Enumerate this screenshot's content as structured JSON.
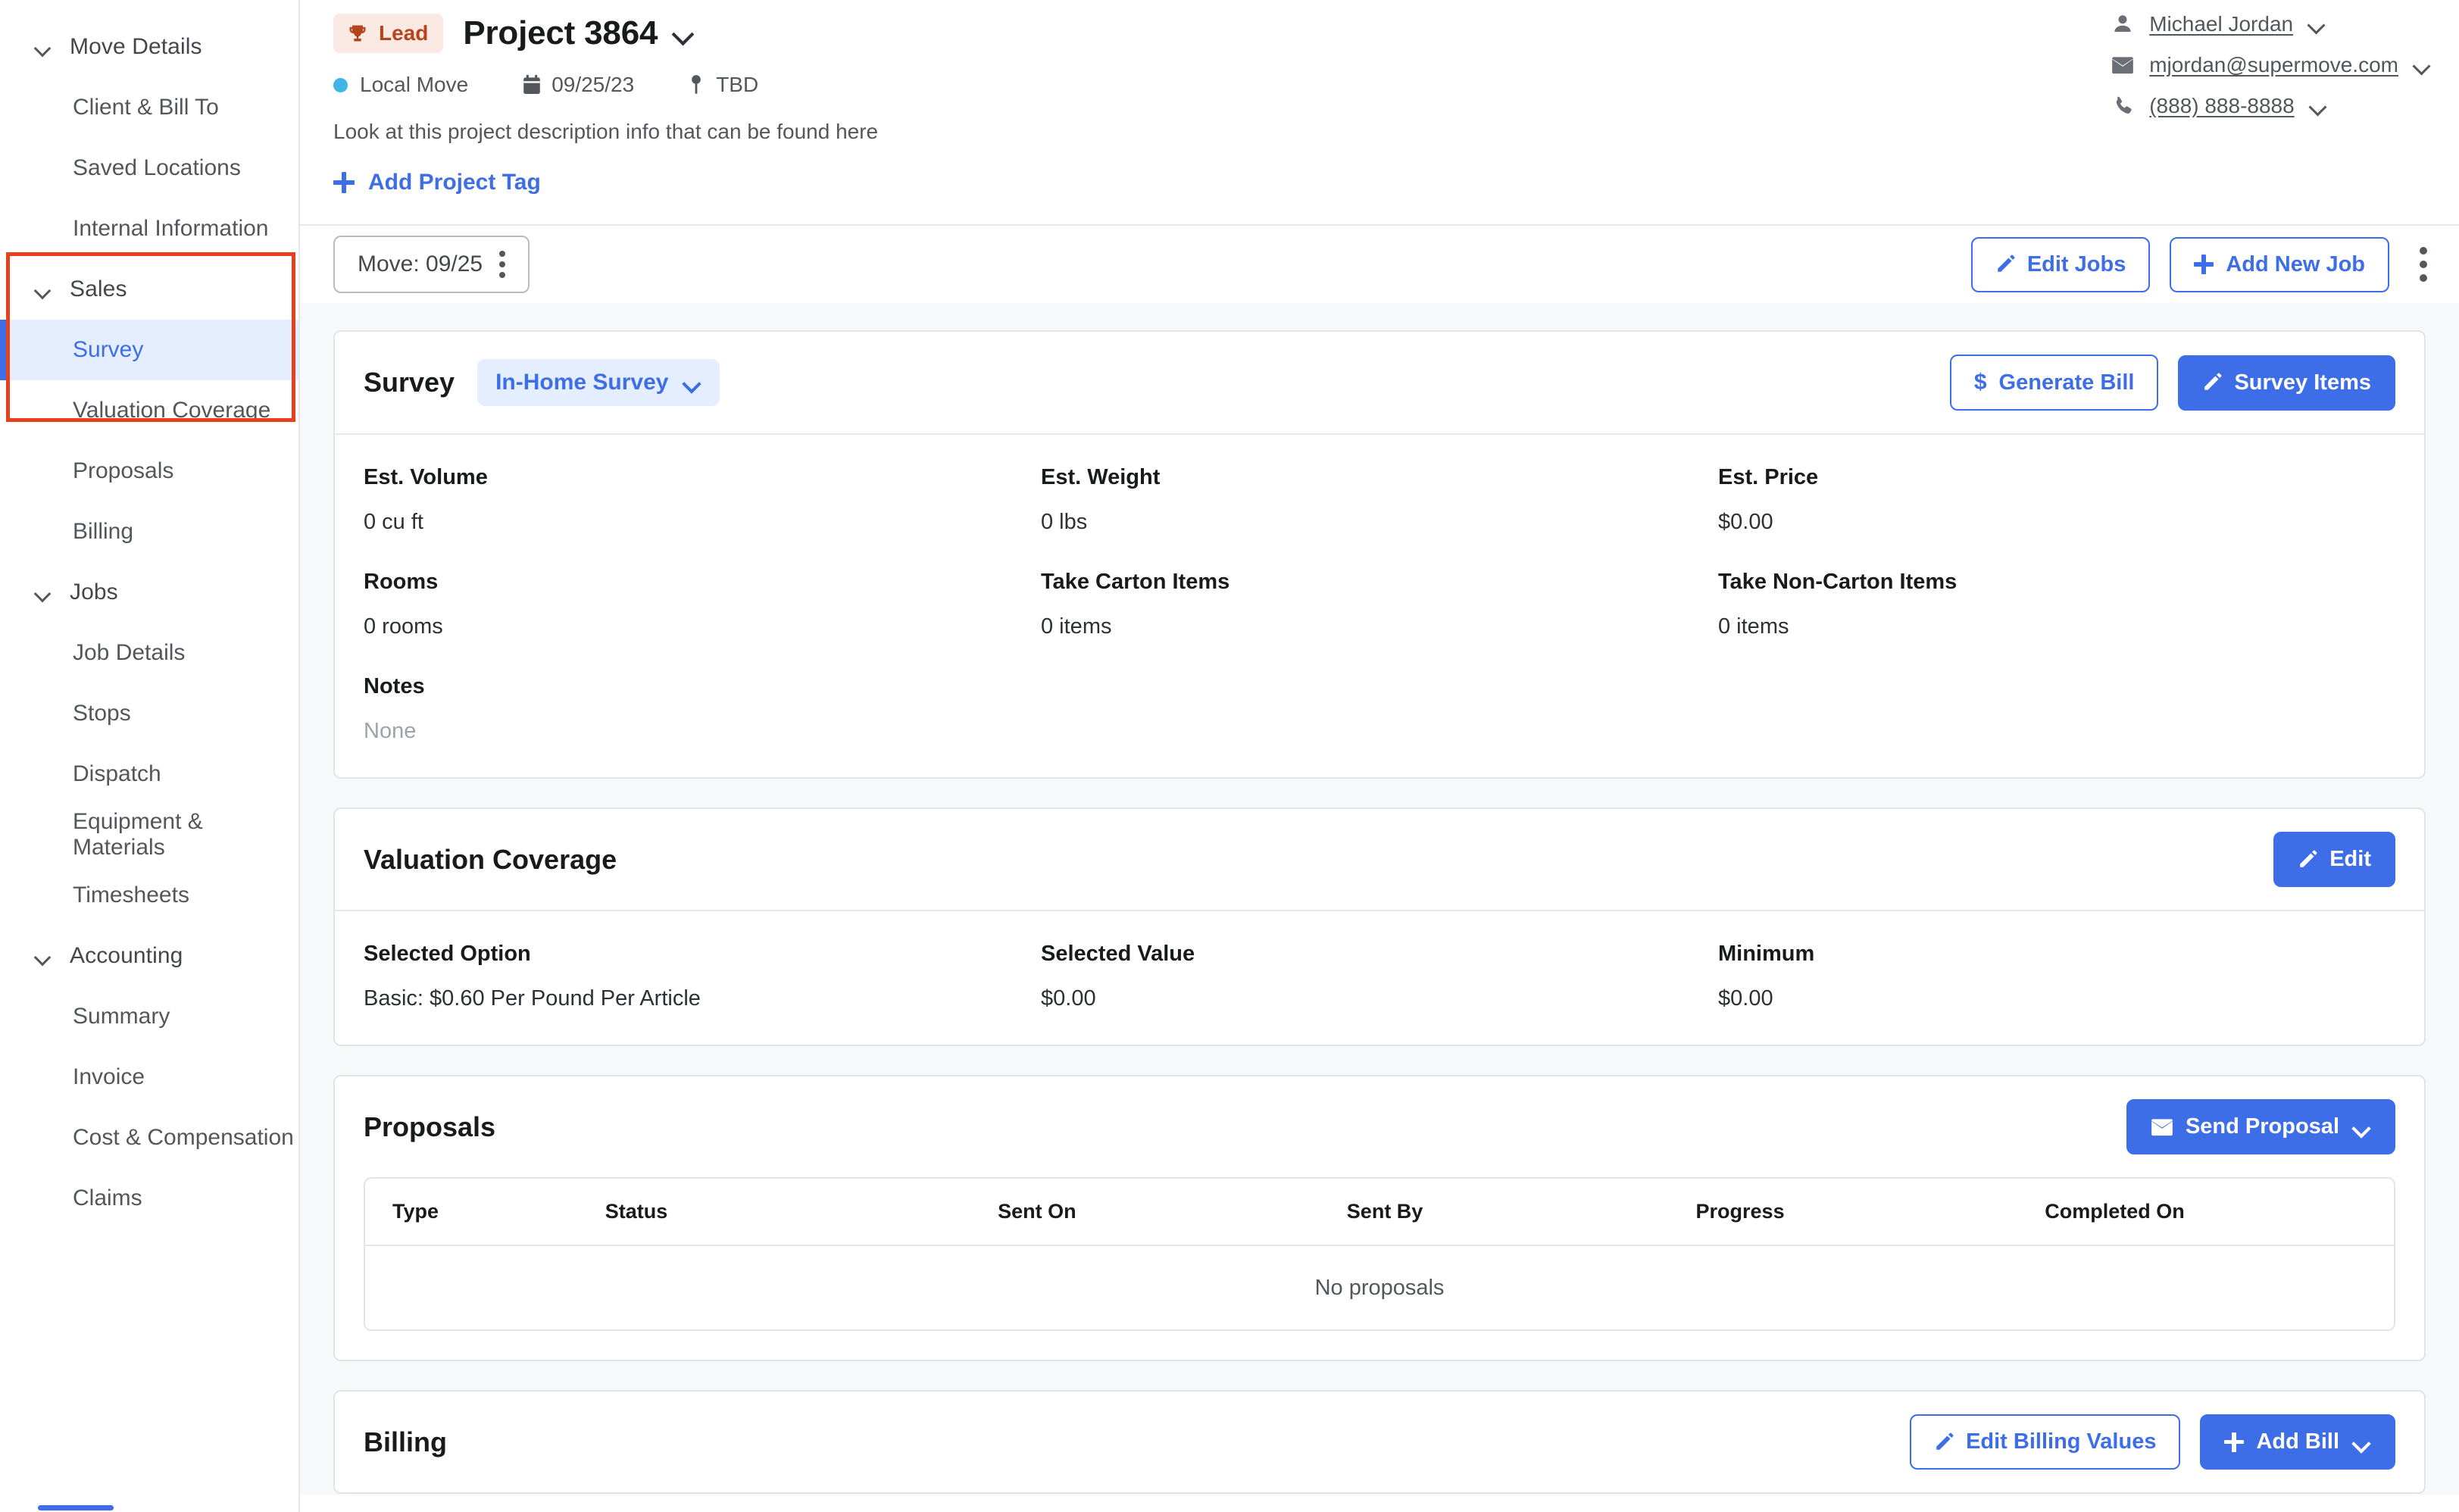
{
  "colors": {
    "accent": "#3d6ee8",
    "accent_soft": "#e4eeff",
    "lead_badge_bg": "#fbeae3",
    "lead_badge_text": "#b5441a",
    "highlight_rect": "#e8401c",
    "move_dot": "#41b6e6"
  },
  "sidebar": {
    "groups": [
      {
        "label": "Move Details",
        "icon": "chevron-down-icon",
        "items": [
          {
            "label": "Client & Bill To",
            "active": false
          },
          {
            "label": "Saved Locations",
            "active": false
          },
          {
            "label": "Internal Information",
            "active": false
          }
        ]
      },
      {
        "label": "Sales",
        "icon": "chevron-down-icon",
        "items": [
          {
            "label": "Survey",
            "active": true
          },
          {
            "label": "Valuation Coverage",
            "active": false
          },
          {
            "label": "Proposals",
            "active": false
          },
          {
            "label": "Billing",
            "active": false
          }
        ]
      },
      {
        "label": "Jobs",
        "icon": "chevron-down-icon",
        "items": [
          {
            "label": "Job Details",
            "active": false
          },
          {
            "label": "Stops",
            "active": false
          },
          {
            "label": "Dispatch",
            "active": false
          },
          {
            "label": "Equipment & Materials",
            "active": false
          },
          {
            "label": "Timesheets",
            "active": false
          }
        ]
      },
      {
        "label": "Accounting",
        "icon": "chevron-down-icon",
        "items": [
          {
            "label": "Summary",
            "active": false
          },
          {
            "label": "Invoice",
            "active": false
          },
          {
            "label": "Cost & Compensation",
            "active": false
          },
          {
            "label": "Claims",
            "active": false
          }
        ]
      }
    ]
  },
  "header": {
    "badge_label": "Lead",
    "badge_icon": "trophy-icon",
    "title": "Project 3864",
    "title_chevron_icon": "chevron-down-icon",
    "meta": {
      "move_type": "Local Move",
      "move_type_icon": "blue-dot-icon",
      "date": "09/25/23",
      "date_icon": "calendar-icon",
      "location": "TBD",
      "location_icon": "map-pin-icon"
    },
    "description": "Look at this project description info that can be found here",
    "add_tag_label": "Add Project Tag",
    "add_tag_icon": "plus-icon"
  },
  "contact": {
    "rows": [
      {
        "icon": "person-icon",
        "text": "Michael Jordan",
        "chevron": "chevron-down-icon"
      },
      {
        "icon": "envelope-icon",
        "text": "mjordan@supermove.com",
        "chevron": "chevron-down-icon"
      },
      {
        "icon": "phone-icon",
        "text": "(888) 888-8888",
        "chevron": "chevron-down-icon"
      }
    ]
  },
  "toolbar": {
    "move_tab_label": "Move: 09/25",
    "move_tab_menu_icon": "kebab-menu-icon",
    "edit_jobs_label": "Edit Jobs",
    "edit_jobs_icon": "pencil-icon",
    "add_new_job_label": "Add New Job",
    "add_new_job_icon": "plus-icon",
    "overflow_icon": "kebab-menu-icon"
  },
  "survey_card": {
    "title": "Survey",
    "type_select_value": "In-Home Survey",
    "type_select_chevron": "chevron-down-icon",
    "generate_bill_label": "Generate Bill",
    "generate_bill_icon": "dollar-icon",
    "survey_items_label": "Survey Items",
    "survey_items_icon": "pencil-icon",
    "stats": [
      {
        "label": "Est. Volume",
        "value": "0 cu ft",
        "muted": false
      },
      {
        "label": "Est. Weight",
        "value": "0  lbs",
        "muted": false
      },
      {
        "label": "Est. Price",
        "value": "$0.00",
        "muted": false
      },
      {
        "label": "Rooms",
        "value": "0 rooms",
        "muted": false
      },
      {
        "label": "Take Carton Items",
        "value": "0 items",
        "muted": false
      },
      {
        "label": "Take Non-Carton Items",
        "value": "0 items",
        "muted": false
      },
      {
        "label": "Notes",
        "value": "None",
        "muted": true
      },
      {
        "label": "",
        "value": "",
        "muted": false
      },
      {
        "label": "",
        "value": "",
        "muted": false
      }
    ]
  },
  "valuation_card": {
    "title": "Valuation Coverage",
    "edit_label": "Edit",
    "edit_icon": "pencil-icon",
    "fields": [
      {
        "label": "Selected Option",
        "value": "Basic: $0.60 Per Pound Per Article"
      },
      {
        "label": "Selected Value",
        "value": "$0.00"
      },
      {
        "label": "Minimum",
        "value": "$0.00"
      }
    ]
  },
  "proposals_card": {
    "title": "Proposals",
    "send_proposal_label": "Send Proposal",
    "send_proposal_icon": "envelope-icon",
    "send_proposal_chevron": "chevron-down-icon",
    "columns": [
      "Type",
      "Status",
      "Sent On",
      "Sent By",
      "Progress",
      "Completed On"
    ],
    "rows": [],
    "empty_text": "No proposals"
  },
  "billing_card": {
    "title": "Billing",
    "edit_billing_label": "Edit Billing Values",
    "edit_billing_icon": "pencil-icon",
    "add_bill_label": "Add Bill",
    "add_bill_icon": "plus-icon",
    "add_bill_chevron": "chevron-down-icon"
  }
}
